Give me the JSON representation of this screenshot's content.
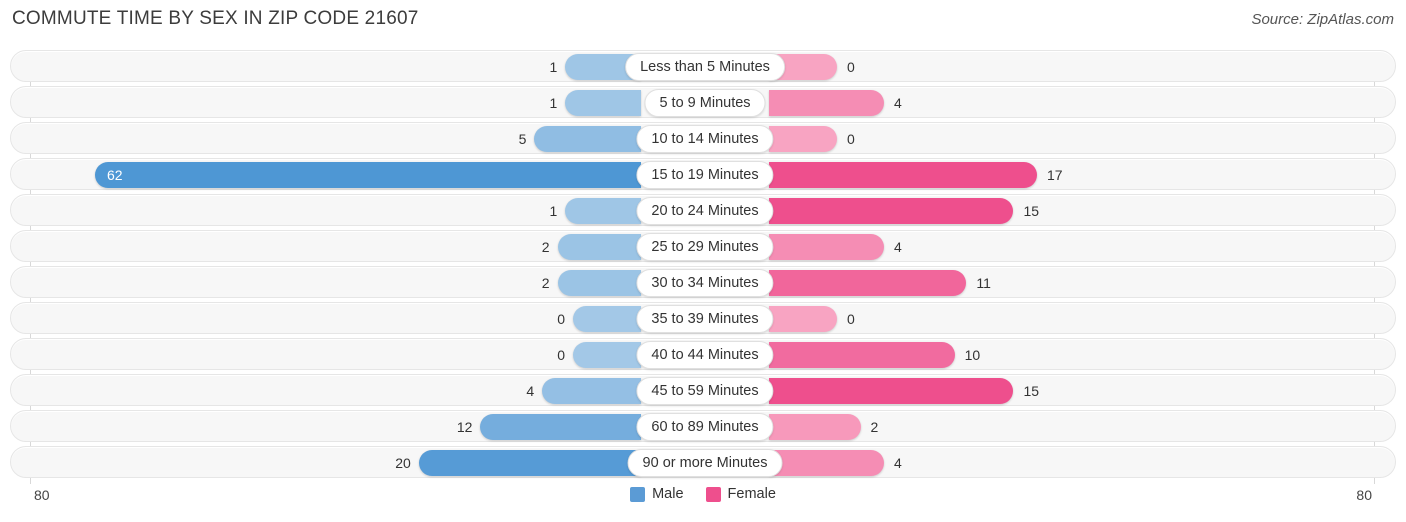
{
  "header": {
    "title": "COMMUTE TIME BY SEX IN ZIP CODE 21607",
    "source": "Source: ZipAtlas.com"
  },
  "axis": {
    "left_tick": "80",
    "right_tick": "80"
  },
  "legend": {
    "items": [
      {
        "label": "Male",
        "color": "#5b9bd5"
      },
      {
        "label": "Female",
        "color": "#ee4f8d"
      }
    ]
  },
  "chart_data": {
    "type": "bar",
    "orientation": "horizontal-diverging",
    "title": "COMMUTE TIME BY SEX IN ZIP CODE 21607",
    "xlabel": "",
    "ylabel": "",
    "xlim": [
      80,
      80
    ],
    "grid": false,
    "legend_position": "bottom-center",
    "categories": [
      "Less than 5 Minutes",
      "5 to 9 Minutes",
      "10 to 14 Minutes",
      "15 to 19 Minutes",
      "20 to 24 Minutes",
      "25 to 29 Minutes",
      "30 to 34 Minutes",
      "35 to 39 Minutes",
      "40 to 44 Minutes",
      "45 to 59 Minutes",
      "60 to 89 Minutes",
      "90 or more Minutes"
    ],
    "series": [
      {
        "name": "Male",
        "color": "#5b9bd5",
        "values": [
          1,
          1,
          5,
          62,
          1,
          2,
          2,
          0,
          0,
          4,
          12,
          20
        ],
        "labels": [
          "1",
          "1",
          "5",
          "62",
          "1",
          "2",
          "2",
          "0",
          "0",
          "4",
          "12",
          "20"
        ]
      },
      {
        "name": "Female",
        "color": "#ee4f8d",
        "values": [
          0,
          4,
          0,
          17,
          15,
          4,
          11,
          0,
          10,
          15,
          2,
          4
        ],
        "labels": [
          "0",
          "4",
          "0",
          "17",
          "15",
          "4",
          "11",
          "0",
          "10",
          "15",
          "2",
          "4"
        ]
      }
    ]
  }
}
